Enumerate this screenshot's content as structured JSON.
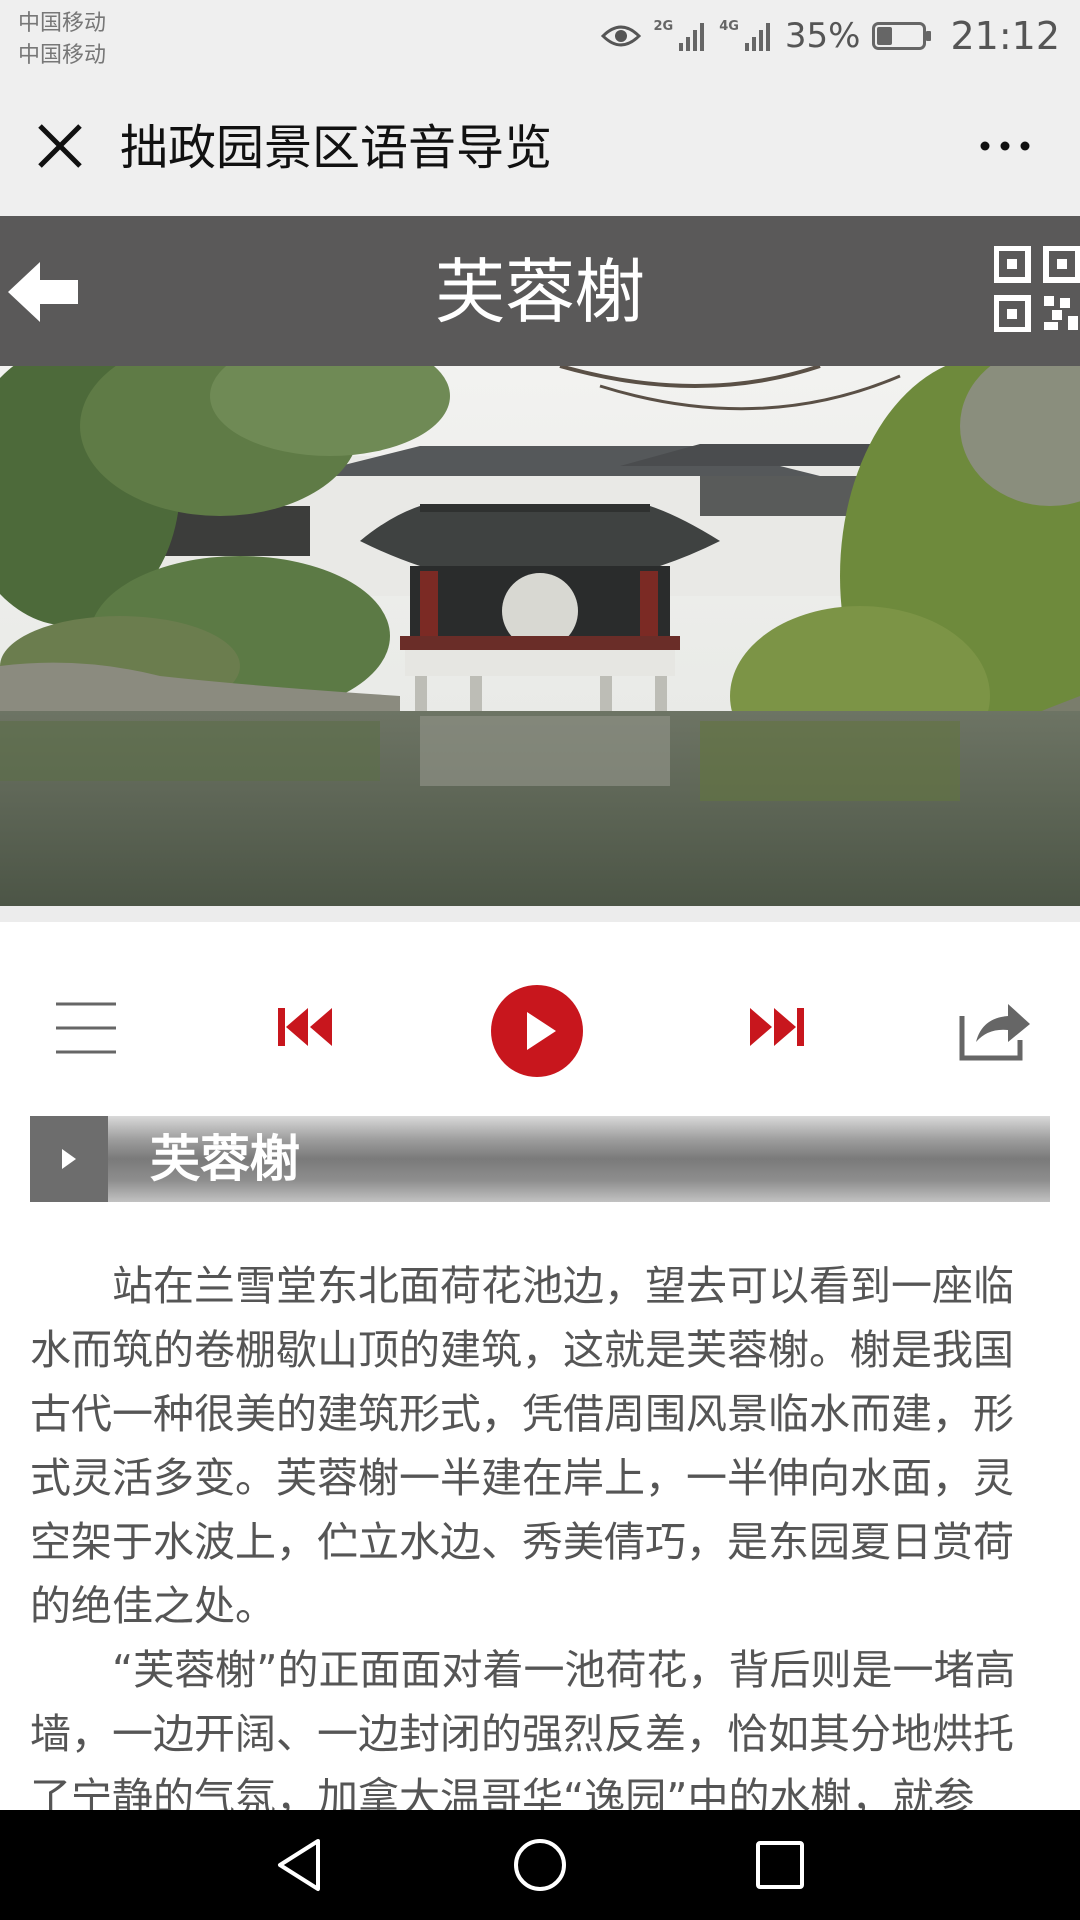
{
  "status_bar": {
    "carrier_1": "中国移动",
    "carrier_2": "中国移动",
    "sim1_label": "2G",
    "sim2_label": "4G",
    "battery_percent": "35%",
    "battery_level": 0.35,
    "time": "21:12"
  },
  "title_bar": {
    "title": "拙政园景区语音导览"
  },
  "header": {
    "title": "芙蓉榭"
  },
  "section": {
    "title": "芙蓉榭"
  },
  "article": {
    "paragraphs": [
      "站在兰雪堂东北面荷花池边，望去可以看到一座临水而筑的卷棚歇山顶的建筑，这就是芙蓉榭。榭是我国古代一种很美的建筑形式，凭借周围风景临水而建，形式灵活多变。芙蓉榭一半建在岸上，一半伸向水面，灵空架于水波上，伫立水边、秀美倩巧，是东园夏日赏荷的绝佳之处。",
      "“芙蓉榭”的正面面对着一池荷花，背后则是一堵高墙，一边开阔、一边封闭的强烈反差，恰如其分地烘托了宁静的气氛，加拿大温哥华“逸园”中的水榭，就参"
    ]
  },
  "colors": {
    "header_bg": "#5a5959",
    "play_red": "#c8161d",
    "bar_bg": "#efefef"
  }
}
